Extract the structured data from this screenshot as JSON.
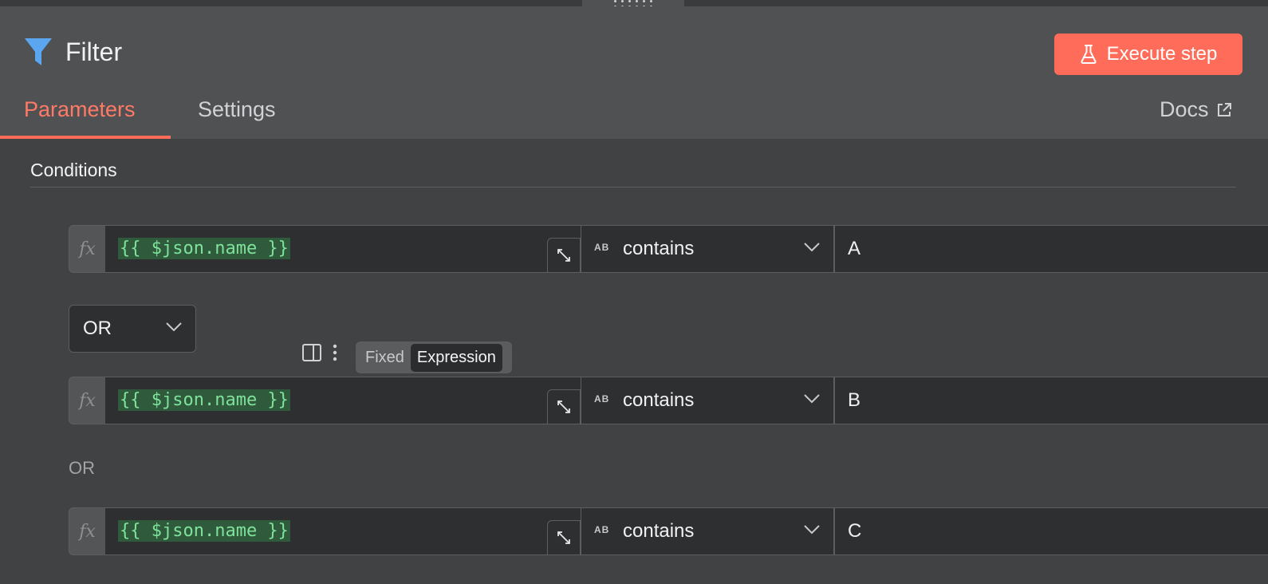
{
  "node": {
    "title": "Filter",
    "icon": "funnel-icon",
    "execute_label": "Execute step"
  },
  "tabs": [
    {
      "label": "Parameters",
      "active": true
    },
    {
      "label": "Settings",
      "active": false
    }
  ],
  "docs_label": "Docs",
  "section_title": "Conditions",
  "conditions": [
    {
      "expression": "{{ $json.name }}",
      "operator": "contains",
      "value": "A",
      "action_icon": "check-circle-icon"
    },
    {
      "expression": "{{ $json.name }}",
      "operator": "contains",
      "value": "B",
      "action_icon": "remove-circle-icon"
    },
    {
      "expression": "{{ $json.name }}",
      "operator": "contains",
      "value": "C",
      "action_icon": "remove-circle-icon"
    }
  ],
  "type_icon_label": "AB",
  "combinator": {
    "selected": "OR",
    "static_label": "OR"
  },
  "mode_toggle": {
    "fixed": "Fixed",
    "expression": "Expression",
    "selected": "Expression"
  },
  "fx_label": "fx",
  "colors": {
    "accent": "#ff6d5a",
    "expression_text": "#7ee29a",
    "expression_bg": "#2f5a3c",
    "funnel": "#5aa6f0"
  }
}
